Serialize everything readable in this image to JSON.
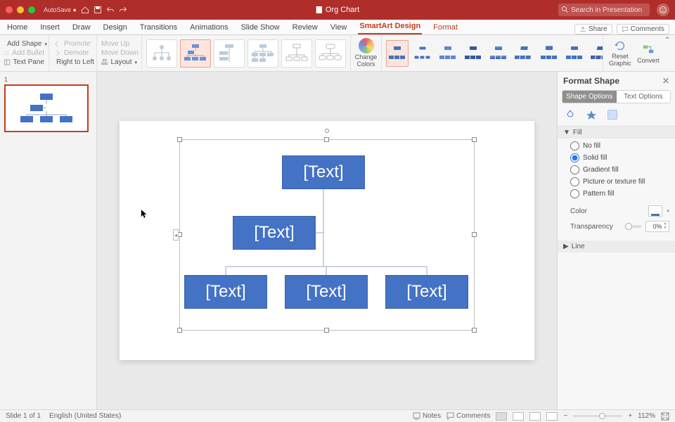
{
  "titlebar": {
    "doc_title": "Org Chart",
    "search_placeholder": "Search in Presentation"
  },
  "menubar": {
    "tabs": [
      "Home",
      "Insert",
      "Draw",
      "Design",
      "Transitions",
      "Animations",
      "Slide Show",
      "Review",
      "View",
      "SmartArt Design",
      "Format"
    ],
    "active_index": 9,
    "share": "Share",
    "comments": "Comments"
  },
  "ribbon": {
    "group_shape": {
      "add_shape": "Add Shape",
      "add_bullet": "Add Bullet",
      "text_pane": "Text Pane",
      "promote": "Promote",
      "demote": "Demote",
      "right_to_left": "Right to Left",
      "move_up": "Move Up",
      "move_down": "Move Down",
      "layout": "Layout"
    },
    "change_colors": "Change\nColors",
    "reset": "Reset\nGraphic",
    "convert": "Convert"
  },
  "slide_thumbs": {
    "first_index": "1"
  },
  "smartart": {
    "placeholder": "[Text]"
  },
  "format_pane": {
    "title": "Format Shape",
    "tab_shape": "Shape Options",
    "tab_text": "Text Options",
    "section_fill": "Fill",
    "section_line": "Line",
    "no_fill": "No fill",
    "solid_fill": "Solid fill",
    "gradient_fill": "Gradient fill",
    "picture_fill": "Picture or texture fill",
    "pattern_fill": "Pattern fill",
    "color_label": "Color",
    "transparency_label": "Transparency",
    "transparency_value": "0%"
  },
  "statusbar": {
    "slide_info": "Slide 1 of 1",
    "language": "English (United States)",
    "notes": "Notes",
    "comments": "Comments",
    "zoom": "112%"
  },
  "colors": {
    "accent": "#b02e2a",
    "node": "#4472c4"
  }
}
